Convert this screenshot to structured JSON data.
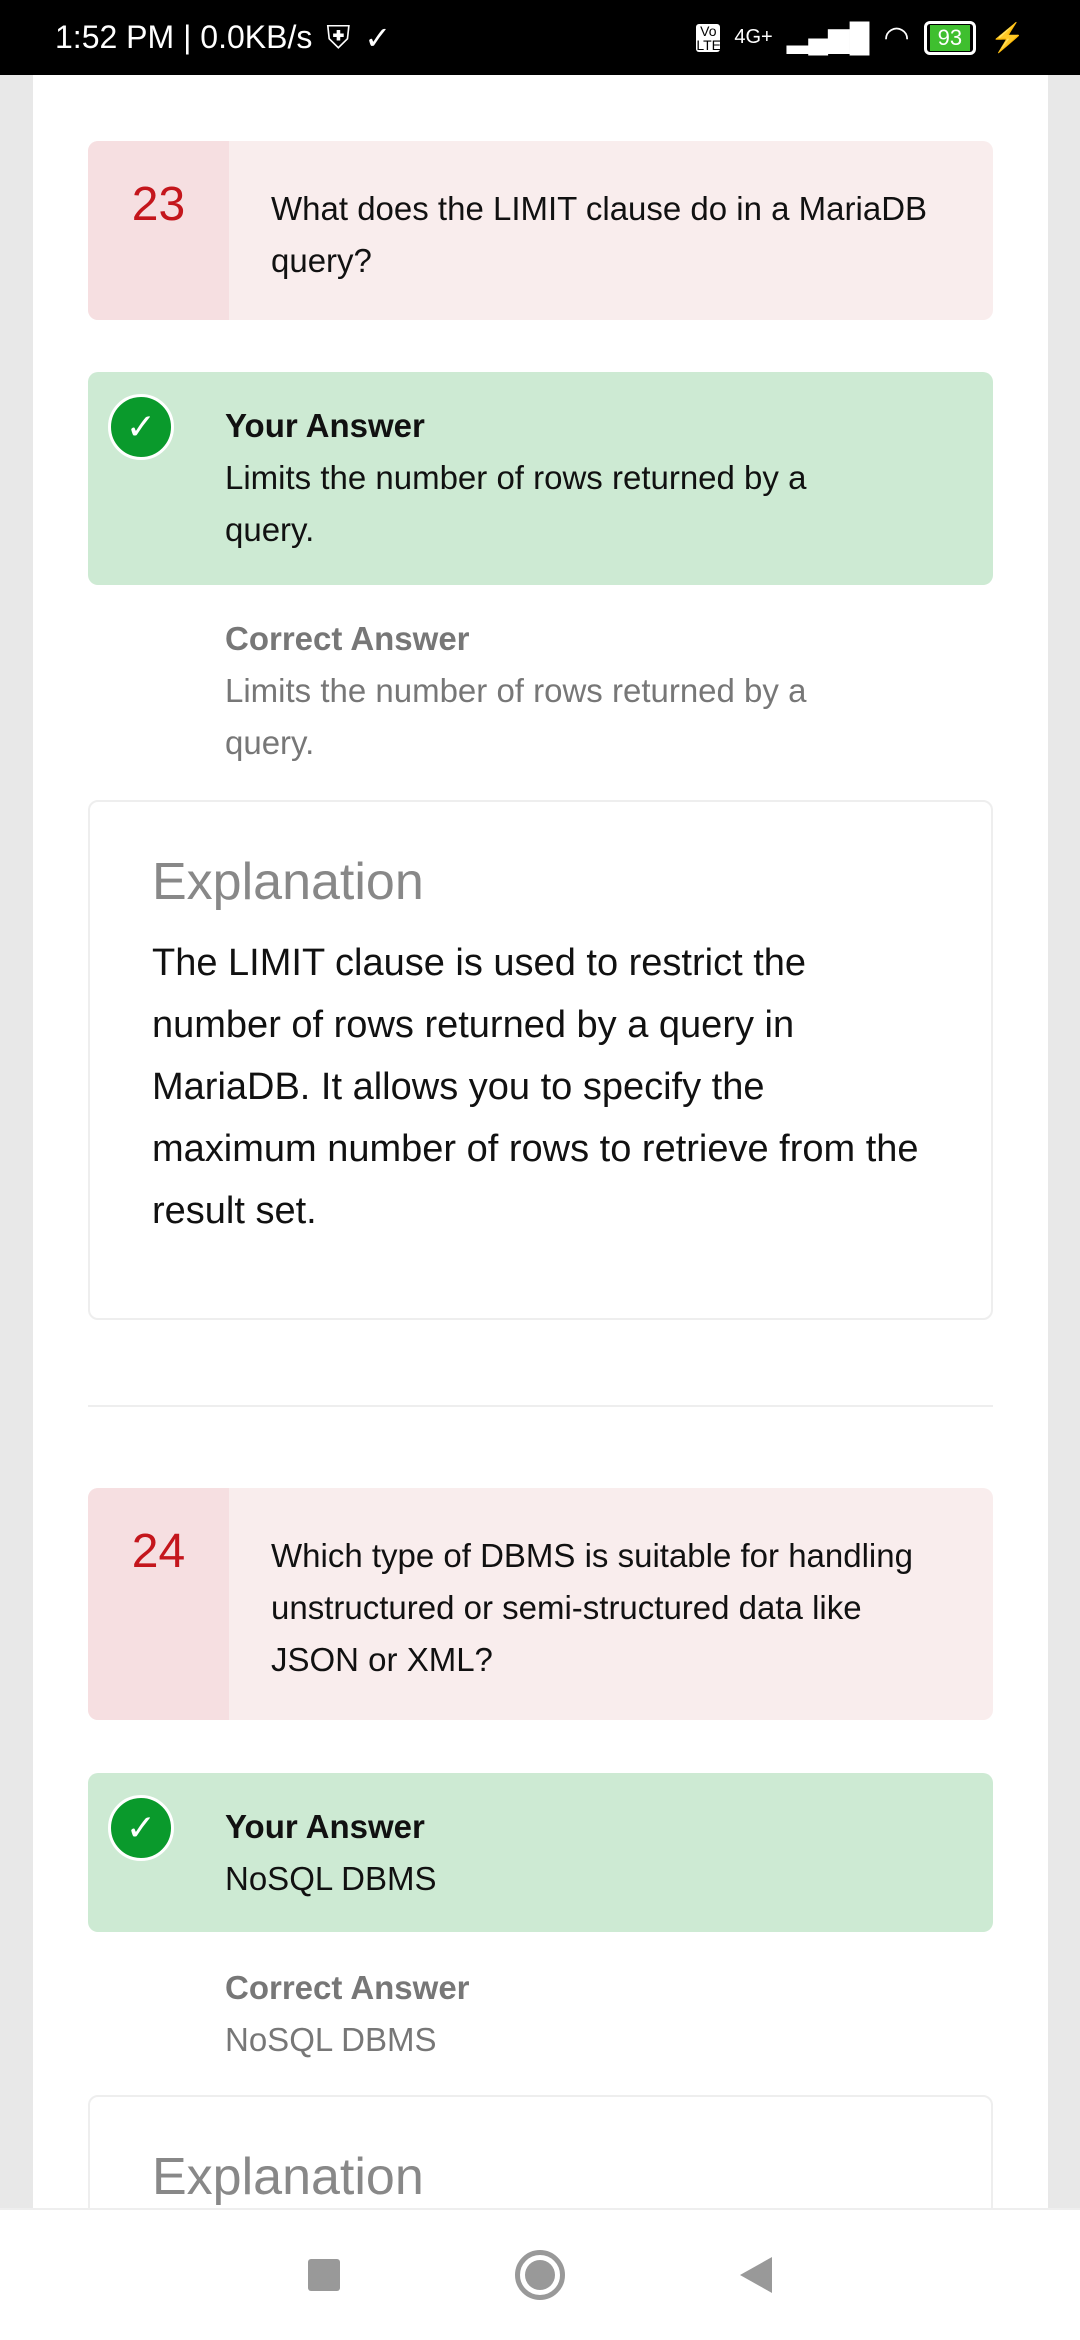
{
  "status": {
    "time": "1:52 PM | 0.0KB/s",
    "network": "4G+",
    "volte": "Vo LTE",
    "battery": "93"
  },
  "questions": [
    {
      "number": "23",
      "text": "What does the LIMIT clause do in a MariaDB query?",
      "your_answer_label": "Your Answer",
      "your_answer": "Limits the number of rows returned by a query.",
      "correct_label": "Correct Answer",
      "correct_answer": "Limits the number of rows returned by a query.",
      "explanation_title": "Explanation",
      "explanation": "The LIMIT clause is used to restrict the number of rows returned by a query in MariaDB. It allows you to specify the maximum number of rows to retrieve from the result set."
    },
    {
      "number": "24",
      "text": "Which type of DBMS is suitable for handling unstructured or semi-structured data like JSON or XML?",
      "your_answer_label": "Your Answer",
      "your_answer": "NoSQL DBMS",
      "correct_label": "Correct Answer",
      "correct_answer": "NoSQL DBMS",
      "explanation_title": "Explanation"
    }
  ]
}
